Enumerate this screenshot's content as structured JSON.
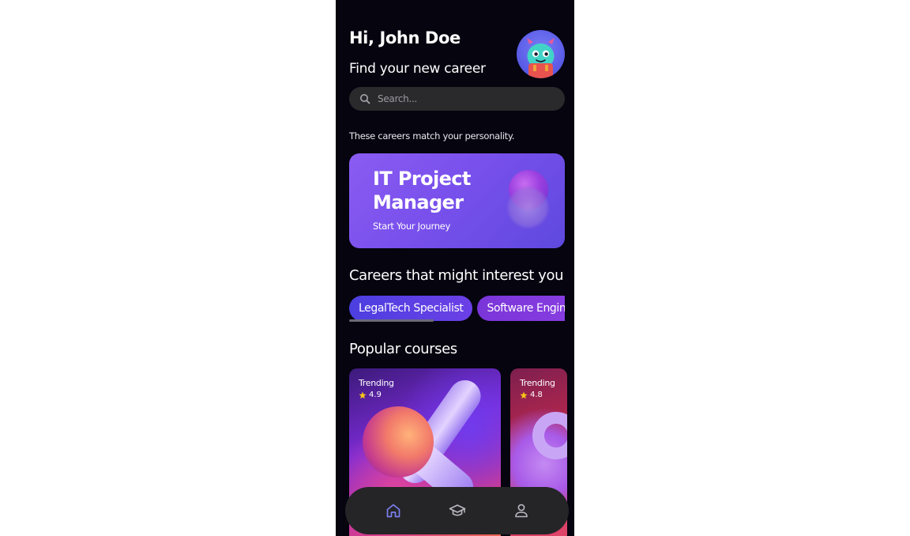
{
  "header": {
    "greeting": "Hi, John Doe",
    "subtitle": "Find your new career"
  },
  "search": {
    "placeholder": "Search..."
  },
  "match": {
    "text": "These careers match your personality."
  },
  "hero": {
    "title": "IT Project Manager",
    "subtitle": "Start Your Journey"
  },
  "interests": {
    "title": "Careers that might interest you",
    "chips": [
      "LegalTech Specialist",
      "Software Engineer"
    ]
  },
  "courses": {
    "title": "Popular courses",
    "items": [
      {
        "badge": "Trending",
        "rating": "4.9"
      },
      {
        "badge": "Trending",
        "rating": "4.8"
      }
    ]
  },
  "nav": {
    "items": [
      "home-icon",
      "graduation-cap-icon",
      "profile-icon"
    ],
    "active": "home-icon"
  },
  "colors": {
    "background": "#05040f",
    "accent": "#7950ec",
    "star": "#f5c518",
    "active_nav": "#7b7ff0"
  }
}
